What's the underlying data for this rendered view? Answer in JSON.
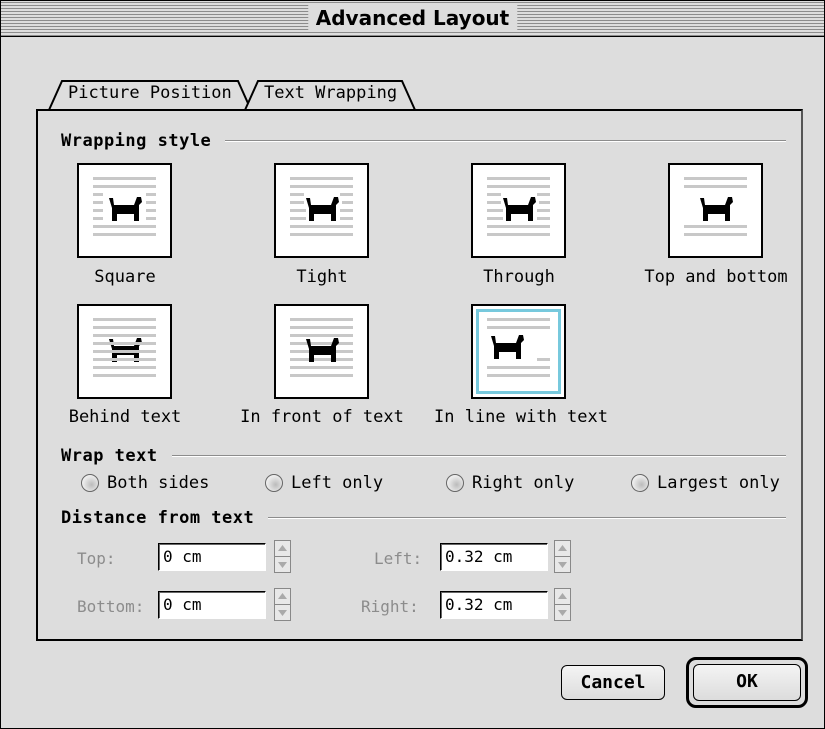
{
  "window": {
    "title": "Advanced Layout"
  },
  "tabs": [
    {
      "label": "Picture Position",
      "selected": false
    },
    {
      "label": "Text Wrapping",
      "selected": true
    }
  ],
  "wrapping_style": {
    "heading": "Wrapping style",
    "options": [
      {
        "label": "Square",
        "icon": "wrap-square-icon",
        "selected": false
      },
      {
        "label": "Tight",
        "icon": "wrap-tight-icon",
        "selected": false
      },
      {
        "label": "Through",
        "icon": "wrap-through-icon",
        "selected": false
      },
      {
        "label": "Top and bottom",
        "icon": "wrap-top-bottom-icon",
        "selected": false
      },
      {
        "label": "Behind text",
        "icon": "wrap-behind-text-icon",
        "selected": false
      },
      {
        "label": "In front of text",
        "icon": "wrap-in-front-icon",
        "selected": false
      },
      {
        "label": "In line with text",
        "icon": "wrap-inline-icon",
        "selected": true
      }
    ],
    "selected_highlight_color": "#77c9dd"
  },
  "wrap_text": {
    "heading": "Wrap text",
    "options": [
      "Both sides",
      "Left only",
      "Right only",
      "Largest only"
    ]
  },
  "distance": {
    "heading": "Distance from text",
    "top": {
      "label": "Top:",
      "value": "0 cm"
    },
    "bottom": {
      "label": "Bottom:",
      "value": "0 cm"
    },
    "left": {
      "label": "Left:",
      "value": "0.32 cm"
    },
    "right": {
      "label": "Right:",
      "value": "0.32 cm"
    }
  },
  "buttons": {
    "cancel": "Cancel",
    "ok": "OK"
  }
}
